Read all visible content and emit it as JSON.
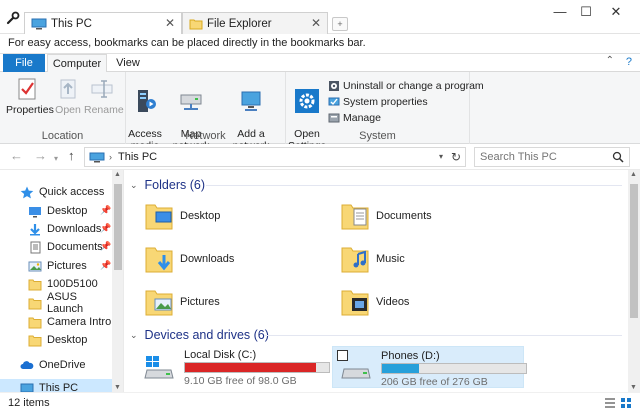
{
  "titlebar": {
    "tabs": [
      {
        "label": "This PC",
        "close": "✕"
      },
      {
        "label": "File Explorer",
        "close": "✕"
      }
    ],
    "new_tab": "+",
    "minimize": "—",
    "maximize": "☐",
    "close": "✕"
  },
  "notice": "For easy access, bookmarks can be placed directly in the bookmarks bar.",
  "ribbon_tabs": {
    "file": "File",
    "computer": "Computer",
    "view": "View",
    "help": "?"
  },
  "ribbon": {
    "location": {
      "label": "Location",
      "properties": "Properties",
      "open": "Open",
      "rename": "Rename"
    },
    "network": {
      "label": "Network",
      "access_media": "Access\nmedia ▾",
      "map_network_drive": "Map network\ndrive ▾",
      "add_network_location": "Add a network\nlocation"
    },
    "system": {
      "label": "System",
      "open_settings": "Open\nSettings",
      "uninstall": "Uninstall or change a program",
      "system_properties": "System properties",
      "manage": "Manage"
    }
  },
  "address": {
    "path": "This PC",
    "search_placeholder": "Search This PC"
  },
  "sidebar": {
    "items": [
      {
        "label": "Quick access",
        "icon": "star-icon"
      },
      {
        "label": "Desktop",
        "icon": "desktop-icon",
        "pinned": true
      },
      {
        "label": "Downloads",
        "icon": "downloads-icon",
        "pinned": true
      },
      {
        "label": "Documents",
        "icon": "documents-icon",
        "pinned": true
      },
      {
        "label": "Pictures",
        "icon": "pictures-icon",
        "pinned": true
      },
      {
        "label": "100D5100",
        "icon": "folder-icon"
      },
      {
        "label": "ASUS Launch",
        "icon": "folder-icon"
      },
      {
        "label": "Camera Intro",
        "icon": "folder-icon"
      },
      {
        "label": "Desktop",
        "icon": "folder-icon"
      },
      {
        "label": "OneDrive",
        "icon": "cloud-icon"
      },
      {
        "label": "This PC",
        "icon": "pc-icon"
      }
    ]
  },
  "main": {
    "folders_header": "Folders (6)",
    "folders": [
      {
        "name": "Desktop",
        "overlay": "desktop"
      },
      {
        "name": "Documents",
        "overlay": "documents"
      },
      {
        "name": "Downloads",
        "overlay": "downloads"
      },
      {
        "name": "Music",
        "overlay": "music"
      },
      {
        "name": "Pictures",
        "overlay": "pictures"
      },
      {
        "name": "Videos",
        "overlay": "videos"
      }
    ],
    "devices_header": "Devices and drives (6)",
    "drives": [
      {
        "name": "Local Disk (C:)",
        "free": "9.10 GB free of 98.0 GB",
        "used_fraction": 0.907,
        "bar_color": "#da2626"
      },
      {
        "name": "Phones (D:)",
        "free": "206 GB free of 276 GB",
        "used_fraction": 0.254,
        "bar_color": "#26a0da"
      }
    ]
  },
  "status": {
    "count": "12 items"
  },
  "colors": {
    "accent": "#1979ca",
    "selection": "#cce8ff",
    "folder": "#f8d775",
    "header_text": "#1e3287"
  }
}
